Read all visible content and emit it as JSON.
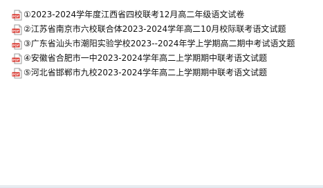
{
  "files": [
    {
      "name": "①2023-2024学年度江西省四校联考12月高二年级语文试卷",
      "icon": "pdf-file-icon"
    },
    {
      "name": "②江苏省南京市六校联合体2023-2024学年高二10月校际联考语文试题",
      "icon": "pdf-file-icon"
    },
    {
      "name": "③广东省汕头市潮阳实验学校2023--2024年学上学期高二期中考试语文题",
      "icon": "pdf-file-icon"
    },
    {
      "name": "④安徽省合肥市一中2023-2024学年高二上学期期中联考语文试题",
      "icon": "pdf-file-icon"
    },
    {
      "name": "⑤河北省邯郸市九校2023-2024学年高二上学期期中联考语文试题",
      "icon": "pdf-file-icon"
    }
  ],
  "colors": {
    "pdf_badge": "#d6281f",
    "page": "#ffffff",
    "text": "#111111"
  }
}
